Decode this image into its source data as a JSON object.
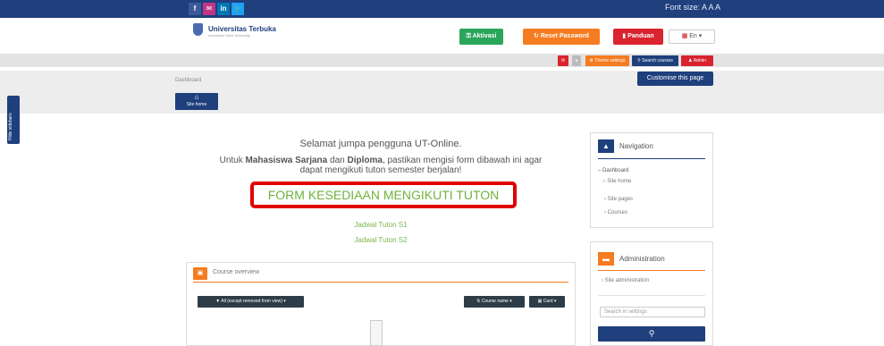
{
  "topbar": {
    "social": [
      "f",
      "✉",
      "in",
      "🐦"
    ],
    "font_size_label": "Font size: A A A"
  },
  "header": {
    "brand": "Universitas Terbuka",
    "brand_sub": "Indonesia Open University",
    "aktivasi": "Aktivasi",
    "reset_password": "Reset Password",
    "panduan": "Panduan",
    "language": "En"
  },
  "toolbar": {
    "theme_settings": "Theme settings",
    "search_courses": "Search courses",
    "admin": "Admin"
  },
  "breadcrumb": "Dashboard",
  "customise_button": "Customise this page",
  "site_home_button": "Site home",
  "sidebar_tab": "Hide sidebars",
  "main": {
    "greeting": "Selamat jumpa pengguna UT-Online.",
    "notice_pre": "Untuk ",
    "notice_sarjana": "Mahasiswa Sarjana",
    "notice_mid": " dan ",
    "notice_diploma": "Diploma",
    "notice_post": ", pastikan mengisi form dibawah ini agar",
    "notice_line2": "dapat mengikuti tuton semester berjalan!",
    "form_link": "FORM KESEDIAAN MENGIKUTI TUTON",
    "jadwal_s1": "Jadwal Tuton S1",
    "jadwal_s2": "Jadwal Tuton S2"
  },
  "course_overview": {
    "title": "Course overview",
    "filter": "All (except removed from view)",
    "sort": "Course name",
    "view": "Card"
  },
  "navigation": {
    "title": "Navigation",
    "items": [
      "Dashboard",
      "Site home",
      "Site pages",
      "Courses"
    ]
  },
  "administration": {
    "title": "Administration",
    "item": "Site administration",
    "search_placeholder": "Search in settings"
  },
  "colors": {
    "primary": "#1f3f7d",
    "accent": "#f57c20",
    "green": "#6eb23c",
    "red_highlight": "#e00000"
  }
}
